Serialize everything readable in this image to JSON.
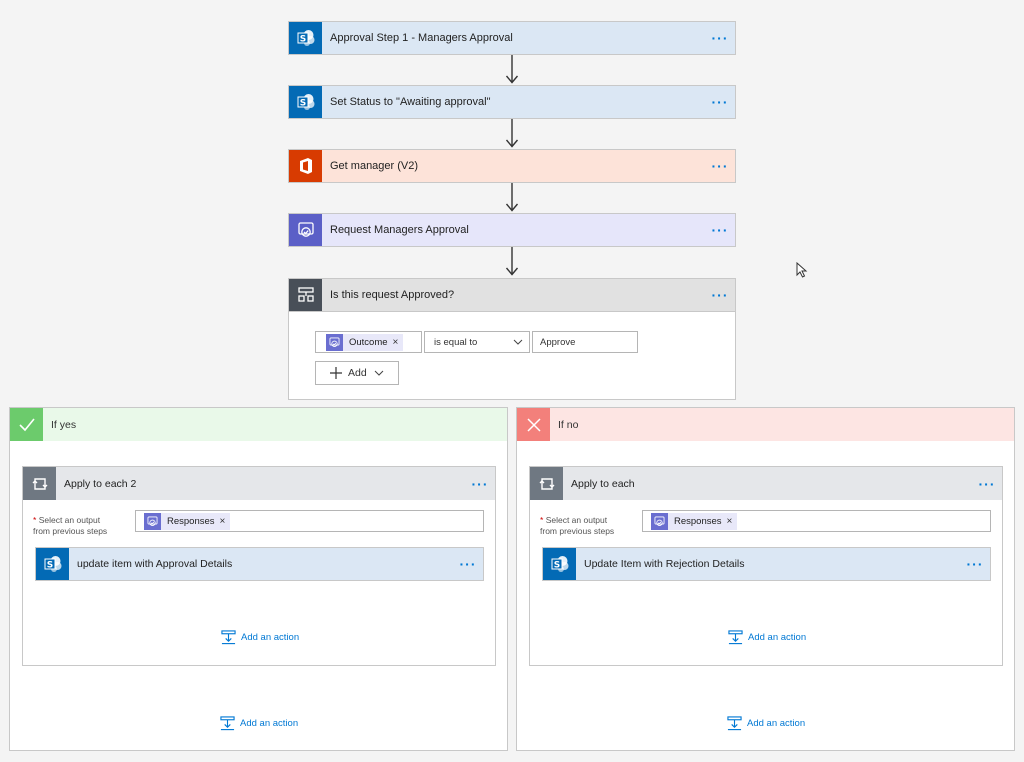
{
  "flow": {
    "steps": [
      {
        "title": "Approval Step 1 - Managers Approval",
        "icon": "sharepoint-icon"
      },
      {
        "title": "Set Status to \"Awaiting approval\"",
        "icon": "sharepoint-icon"
      },
      {
        "title": "Get manager (V2)",
        "icon": "office365-icon"
      },
      {
        "title": "Request Managers Approval",
        "icon": "approvals-icon"
      }
    ],
    "more_label": "···"
  },
  "condition": {
    "title": "Is this request Approved?",
    "left_token": "Outcome",
    "remove_glyph": "×",
    "operator": "is equal to",
    "value": "Approve",
    "add_label": "Add"
  },
  "branch_yes": {
    "label": "If yes",
    "loop": {
      "title": "Apply to each 2",
      "select_required": "*",
      "select_label_line1": "Select an output",
      "select_label_line2": "from previous steps",
      "token": "Responses",
      "inner_step": "update item with Approval Details",
      "add_action": "Add an action"
    },
    "add_action": "Add an action"
  },
  "branch_no": {
    "label": "If no",
    "loop": {
      "title": "Apply to each",
      "select_required": "*",
      "select_label_line1": "Select an output",
      "select_label_line2": "from previous steps",
      "token": "Responses",
      "inner_step": "Update Item with Rejection Details",
      "add_action": "Add an action"
    },
    "add_action": "Add an action"
  },
  "colors": {
    "sharepoint": "#036ab5",
    "office": "#d83b01",
    "approvals": "#5b5fc7",
    "condition": "#484f58",
    "yes": "#6ccb6c",
    "no": "#f3807b",
    "link": "#0078d4"
  }
}
